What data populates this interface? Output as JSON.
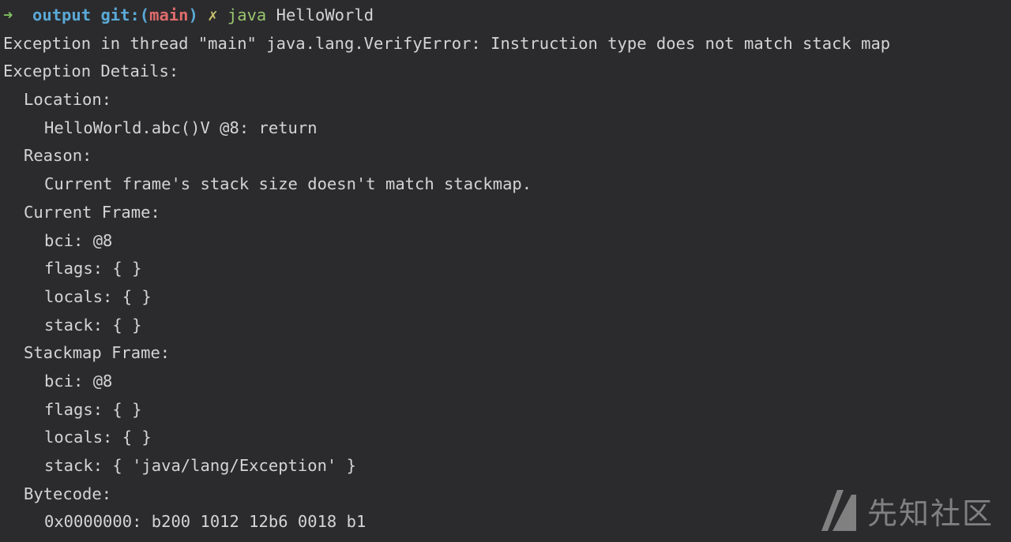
{
  "prompt": {
    "arrow": "➜",
    "directory": "output",
    "git_prefix": "git:(",
    "branch": "main",
    "git_suffix": ")",
    "dirty_marker": "✗",
    "command": "java",
    "argument": "HelloWorld"
  },
  "output_lines": [
    {
      "indent": 0,
      "text": "Exception in thread \"main\" java.lang.VerifyError: Instruction type does not match stack map"
    },
    {
      "indent": 0,
      "text": "Exception Details:"
    },
    {
      "indent": 1,
      "text": "Location:"
    },
    {
      "indent": 2,
      "text": "HelloWorld.abc()V @8: return"
    },
    {
      "indent": 1,
      "text": "Reason:"
    },
    {
      "indent": 2,
      "text": "Current frame's stack size doesn't match stackmap."
    },
    {
      "indent": 1,
      "text": "Current Frame:"
    },
    {
      "indent": 2,
      "text": "bci: @8"
    },
    {
      "indent": 2,
      "text": "flags: { }"
    },
    {
      "indent": 2,
      "text": "locals: { }"
    },
    {
      "indent": 2,
      "text": "stack: { }"
    },
    {
      "indent": 1,
      "text": "Stackmap Frame:"
    },
    {
      "indent": 2,
      "text": "bci: @8"
    },
    {
      "indent": 2,
      "text": "flags: { }"
    },
    {
      "indent": 2,
      "text": "locals: { }"
    },
    {
      "indent": 2,
      "text": "stack: { 'java/lang/Exception' }"
    },
    {
      "indent": 1,
      "text": "Bytecode:"
    },
    {
      "indent": 2,
      "text": "0x0000000: b200 1012 12b6 0018 b1"
    }
  ],
  "watermark": {
    "text": "先知社区"
  },
  "colors": {
    "background": "#2b2b2d",
    "text": "#d4d4d6",
    "prompt_arrow": "#7fbf5f",
    "prompt_dir": "#5aa9d6",
    "branch": "#e06c6c",
    "dirty": "#c9c36e",
    "command": "#98c56e"
  }
}
